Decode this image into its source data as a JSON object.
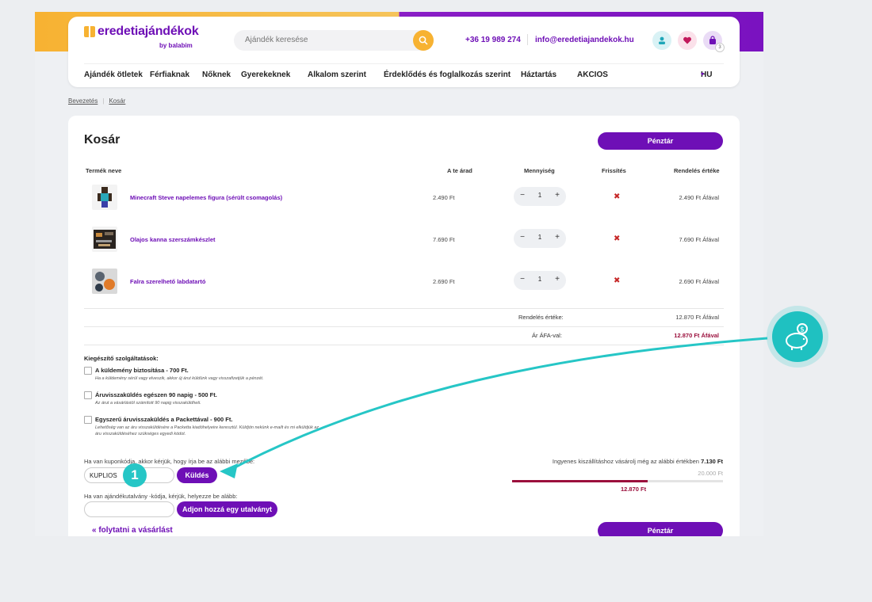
{
  "header": {
    "logo_name": "eredetiajándékok",
    "logo_sub": "by balabim",
    "search_placeholder": "Ajándék keresése",
    "phone": "+36 19 989 274",
    "email": "info@eredetiajandekok.hu",
    "cart_count": "3",
    "nav": [
      "Ajándék ötletek",
      "Férfiaknak",
      "Nőknek",
      "Gyerekeknek",
      "Alkalom szerint",
      "Érdeklődés és foglalkozás szerint",
      "Háztartás",
      "AKCIOS"
    ],
    "language": "HU"
  },
  "breadcrumb": [
    "Bevezetés",
    "Kosár"
  ],
  "cart": {
    "title": "Kosár",
    "checkout_label": "Pénztár",
    "columns": {
      "name": "Termék neve",
      "price": "A te árad",
      "qty": "Mennyiség",
      "update": "Frissítés",
      "total": "Rendelés értéke"
    },
    "items": [
      {
        "name": "Minecraft Steve napelemes figura (sérült csomagolás)",
        "price": "2.490 Ft",
        "qty": "1",
        "total": "2.490 Ft Áfával"
      },
      {
        "name": "Olajos kanna szerszámkészlet",
        "price": "7.690 Ft",
        "qty": "1",
        "total": "7.690 Ft Áfával"
      },
      {
        "name": "Falra szerelhető labdatartó",
        "price": "2.690 Ft",
        "qty": "1",
        "total": "2.690 Ft Áfával"
      }
    ],
    "qty_minus": "−",
    "qty_plus": "+",
    "remove_symbol": "✖",
    "summary": {
      "order_value_label": "Rendelés értéke:",
      "order_value": "12.870 Ft Áfával",
      "vat_label": "Ár ÁFA-val:",
      "vat_value": "12.870 Ft Áfával"
    }
  },
  "services": {
    "title": "Kiegészítő szolgáltatások:",
    "items": [
      {
        "title": "A küldemény biztosítása - 700 Ft.",
        "desc": "Ha a küldemény sérül vagy elveszik, akkor új árut küldünk vagy visszafizetjük a pénzét."
      },
      {
        "title": "Áruvisszaküldés egészen 90 napig - 500 Ft.",
        "desc": "Az árut a vásárlástól számított 90 napig visszaküldheti."
      },
      {
        "title": "Egyszerű áruvisszaküldés a Packettával - 900 Ft.",
        "desc": "Lehetőség van az áru visszaküldésére a Packetta kiadóhelyeire keresztül. Küldjön nekünk e-mailt és mi elküldjük az áru visszaküldéséhez szükséges egyedi kódot."
      }
    ]
  },
  "coupon": {
    "label": "Ha van kuponkódja, akkor kérjük, hogy írja be az alábbi mezőbe:",
    "value": "KUPLIOS",
    "button": "Küldés"
  },
  "voucher": {
    "label": "Ha van ajándékutalvány -kódja, kérjük, helyezze be alább:",
    "button": "Adjon hozzá egy utalványt"
  },
  "shipping": {
    "text": "Ingyenes kiszállításhoz vásárolj még az alábbi értékben",
    "remaining": "7.130 Ft",
    "threshold": "20.000 Ft",
    "current": "12.870 Ft",
    "progress": 0.6435
  },
  "continue_label": "« folytatni a vásárlást",
  "annotation": {
    "step": "1"
  },
  "colors": {
    "brand": "#6e0fb6",
    "accent": "#f7b232",
    "teal": "#26c6c6",
    "price_red": "#9b0f3c"
  }
}
